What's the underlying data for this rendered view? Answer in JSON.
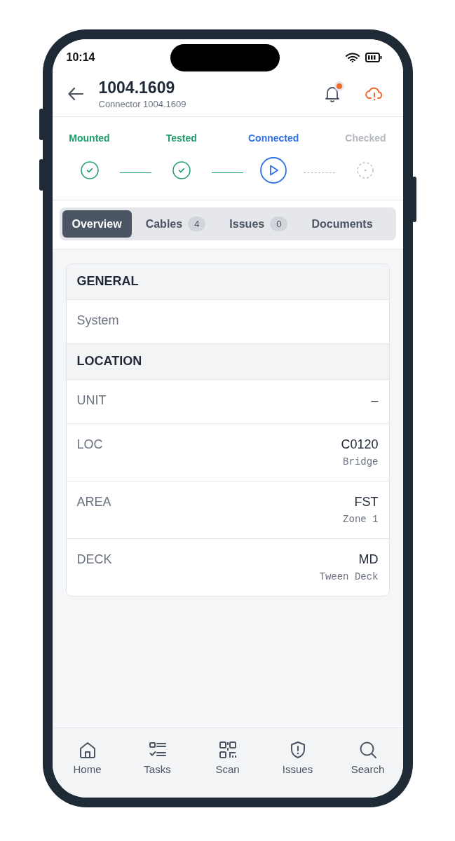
{
  "status_bar": {
    "time": "10:14"
  },
  "header": {
    "title": "1004.1609",
    "subtitle": "Connector 1004.1609",
    "notification_unread": true
  },
  "steps": [
    {
      "label": "Mounted",
      "kind": "done"
    },
    {
      "label": "Tested",
      "kind": "done"
    },
    {
      "label": "Connected",
      "kind": "current"
    },
    {
      "label": "Checked",
      "kind": "pending"
    }
  ],
  "tabs": [
    {
      "label": "Overview",
      "selected": true
    },
    {
      "label": "Cables",
      "badge": "4",
      "selected": false
    },
    {
      "label": "Issues",
      "badge": "0",
      "selected": false
    },
    {
      "label": "Documents",
      "selected": false
    }
  ],
  "sections": [
    {
      "title": "GENERAL",
      "rows": [
        {
          "label": "System"
        }
      ]
    },
    {
      "title": "LOCATION",
      "rows": [
        {
          "label": "UNIT",
          "value": "–"
        },
        {
          "label": "LOC",
          "value": "C0120",
          "sub": "Bridge"
        },
        {
          "label": "AREA",
          "value": "FST",
          "sub": "Zone 1"
        },
        {
          "label": "DECK",
          "value": "MD",
          "sub": "Tween Deck"
        }
      ]
    }
  ],
  "nav": [
    {
      "label": "Home",
      "kind": "home"
    },
    {
      "label": "Tasks",
      "kind": "tasks"
    },
    {
      "label": "Scan",
      "kind": "scan"
    },
    {
      "label": "Issues",
      "kind": "issues"
    },
    {
      "label": "Search",
      "kind": "search"
    }
  ]
}
